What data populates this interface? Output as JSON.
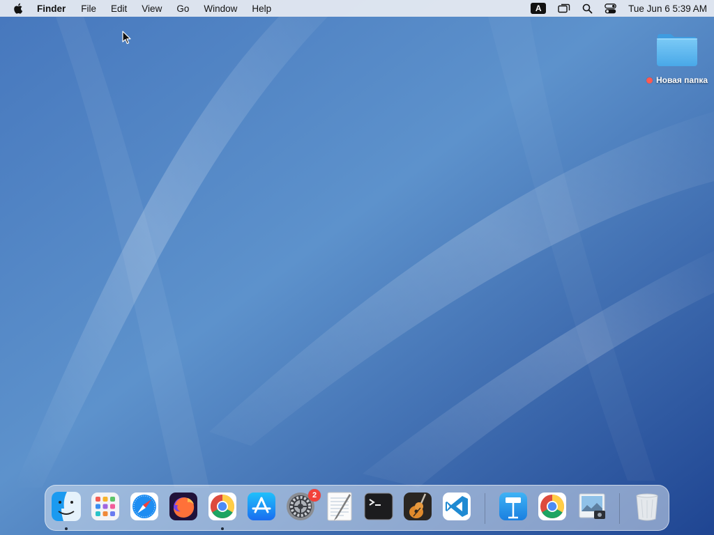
{
  "menubar": {
    "app_name": "Finder",
    "menus": [
      "File",
      "Edit",
      "View",
      "Go",
      "Window",
      "Help"
    ],
    "input_source": "A",
    "clock": "Tue Jun 6  5:39 AM"
  },
  "desktop": {
    "folder_label": "Новая папка",
    "folder_tag_color": "#ff5a52"
  },
  "dock": {
    "apps": [
      {
        "name": "finder-icon",
        "running": true
      },
      {
        "name": "launchpad-icon",
        "running": false
      },
      {
        "name": "safari-icon",
        "running": false
      },
      {
        "name": "firefox-icon",
        "running": false
      },
      {
        "name": "chrome-icon",
        "running": true
      },
      {
        "name": "app-store-icon",
        "running": false
      },
      {
        "name": "system-preferences-icon",
        "running": false
      },
      {
        "name": "textedit-icon",
        "running": false
      },
      {
        "name": "terminal-icon",
        "running": false
      },
      {
        "name": "garageband-icon",
        "running": false
      },
      {
        "name": "vscode-icon",
        "running": false
      },
      {
        "name": "keynote-icon",
        "running": false
      },
      {
        "name": "chrome-icon",
        "running": false
      },
      {
        "name": "preview-icon",
        "running": false
      },
      {
        "name": "trash-icon",
        "running": false
      }
    ],
    "system_preferences_badge": "2"
  },
  "colors": {
    "wallpaper_base": "#2d5ea8",
    "wallpaper_light": "#6fa3d6",
    "folder_blue": "#5bb8f0",
    "badge_red": "#f2413a"
  }
}
